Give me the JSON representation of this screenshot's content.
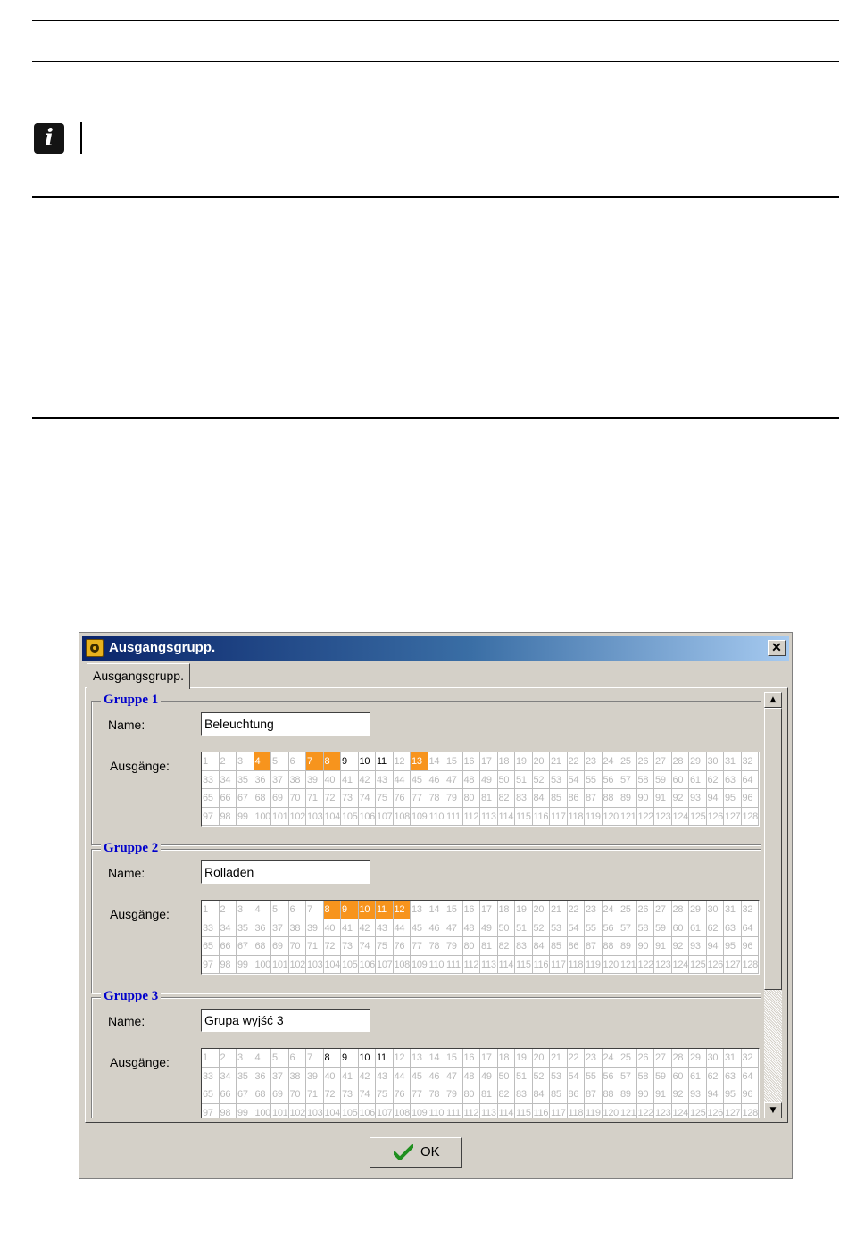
{
  "info": {
    "icon": "info-icon",
    "glyph": "i"
  },
  "window": {
    "title": "Ausgangsgrupp.",
    "close_glyph": "✕"
  },
  "tab": {
    "label": "Ausgangsgrupp."
  },
  "labels": {
    "name": "Name:",
    "outputs": "Ausgänge:"
  },
  "groups": [
    {
      "title": "Gruppe 1",
      "name": "Beleuchtung",
      "selected": [
        4,
        7,
        8,
        13
      ],
      "active": [
        9,
        10,
        11
      ]
    },
    {
      "title": "Gruppe 2",
      "name": "Rolladen",
      "selected": [
        8,
        9,
        10,
        11,
        12
      ],
      "active": []
    },
    {
      "title": "Gruppe 3",
      "name": "Grupa wyjść 3",
      "selected": [],
      "active": [
        8,
        9,
        10,
        11
      ]
    }
  ],
  "ok_button": {
    "label": "OK",
    "icon": "check-icon"
  },
  "colors": {
    "selected": "#f7941d",
    "legend": "#0000cc",
    "titlebar_start": "#0a246a"
  }
}
